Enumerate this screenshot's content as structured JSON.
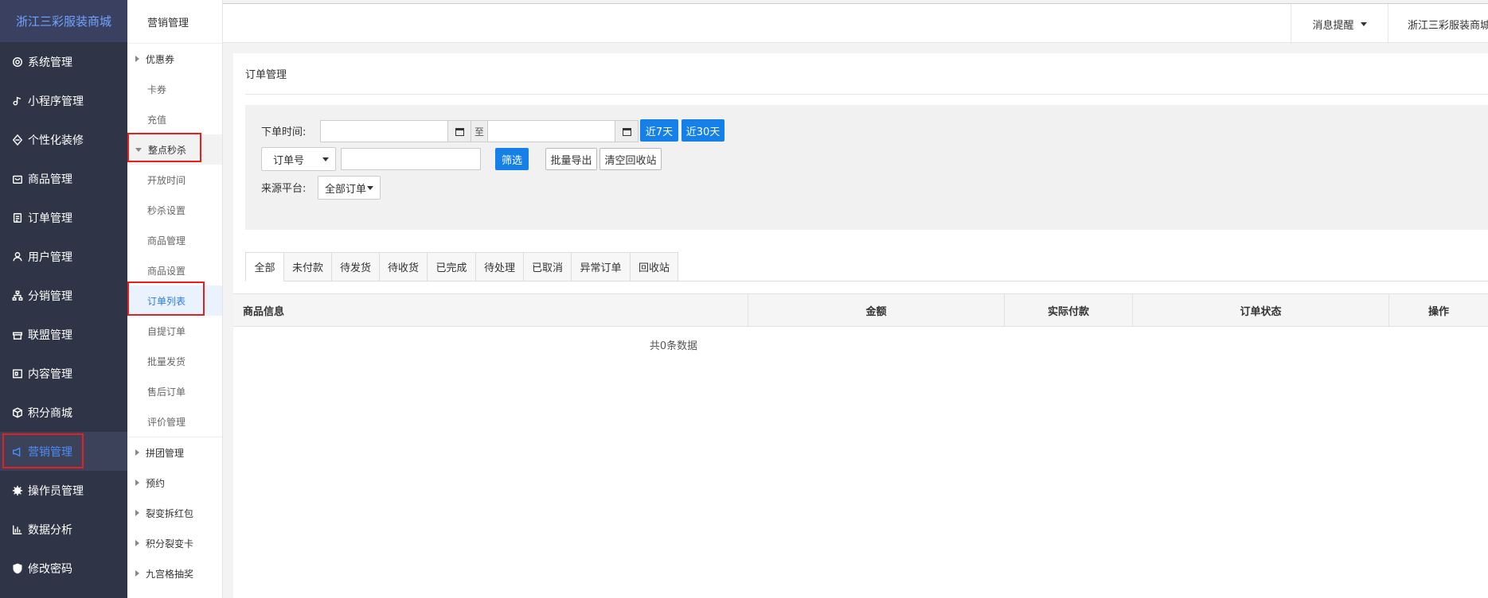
{
  "brand": "浙江三彩服装商城",
  "sidebar": {
    "items": [
      {
        "label": "系统管理",
        "icon": "gear-outline-icon"
      },
      {
        "label": "小程序管理",
        "icon": "music-note-icon"
      },
      {
        "label": "个性化装修",
        "icon": "diamond-icon"
      },
      {
        "label": "商品管理",
        "icon": "bag-icon"
      },
      {
        "label": "订单管理",
        "icon": "clipboard-icon"
      },
      {
        "label": "用户管理",
        "icon": "user-icon"
      },
      {
        "label": "分销管理",
        "icon": "hierarchy-icon"
      },
      {
        "label": "联盟管理",
        "icon": "store-icon"
      },
      {
        "label": "内容管理",
        "icon": "layout-icon"
      },
      {
        "label": "积分商城",
        "icon": "cube-icon"
      },
      {
        "label": "营销管理",
        "icon": "megaphone-icon"
      },
      {
        "label": "操作员管理",
        "icon": "cog-filled-icon"
      },
      {
        "label": "数据分析",
        "icon": "bar-chart-icon"
      },
      {
        "label": "修改密码",
        "icon": "shield-icon"
      }
    ],
    "active": "营销管理"
  },
  "submenu": {
    "title": "营销管理",
    "items": [
      {
        "label": "优惠券",
        "level": 1
      },
      {
        "label": "卡券",
        "level": 2
      },
      {
        "label": "充值",
        "level": 2
      },
      {
        "label": "整点秒杀",
        "level": 1,
        "open": true
      },
      {
        "label": "开放时间",
        "level": 2
      },
      {
        "label": "秒杀设置",
        "level": 2
      },
      {
        "label": "商品管理",
        "level": 2
      },
      {
        "label": "商品设置",
        "level": 2
      },
      {
        "label": "订单列表",
        "level": 2,
        "active": true
      },
      {
        "label": "自提订单",
        "level": 2
      },
      {
        "label": "批量发货",
        "level": 2
      },
      {
        "label": "售后订单",
        "level": 2
      },
      {
        "label": "评价管理",
        "level": 2
      },
      {
        "label": "拼团管理",
        "level": 1
      },
      {
        "label": "预约",
        "level": 1
      },
      {
        "label": "裂变拆红包",
        "level": 1
      },
      {
        "label": "积分裂变卡",
        "level": 1
      },
      {
        "label": "九宫格抽奖",
        "level": 1
      }
    ]
  },
  "topbar": {
    "message": "消息提醒",
    "shop": "浙江三彩服装商城"
  },
  "panel": {
    "title": "订单管理",
    "filter": {
      "order_time_label": "下单时间:",
      "to_label": "至",
      "start_date": "",
      "end_date": "",
      "last7": "近7天",
      "last30": "近30天",
      "search_type": "订单号",
      "search_value": "",
      "filter_btn": "筛选",
      "export_btn": "批量导出",
      "recycle_btn": "清空回收站",
      "source_label": "来源平台:",
      "source_value": "全部订单"
    },
    "tabs": [
      "全部",
      "未付款",
      "待发货",
      "待收货",
      "已完成",
      "待处理",
      "已取消",
      "异常订单",
      "回收站"
    ],
    "active_tab": "全部",
    "table": {
      "columns": [
        "商品信息",
        "金额",
        "实际付款",
        "订单状态",
        "操作"
      ],
      "empty_text": "共0条数据"
    }
  },
  "colors": {
    "sidebar_bg": "#2f3446",
    "accent": "#1580e8",
    "highlight_box": "#e62020"
  }
}
